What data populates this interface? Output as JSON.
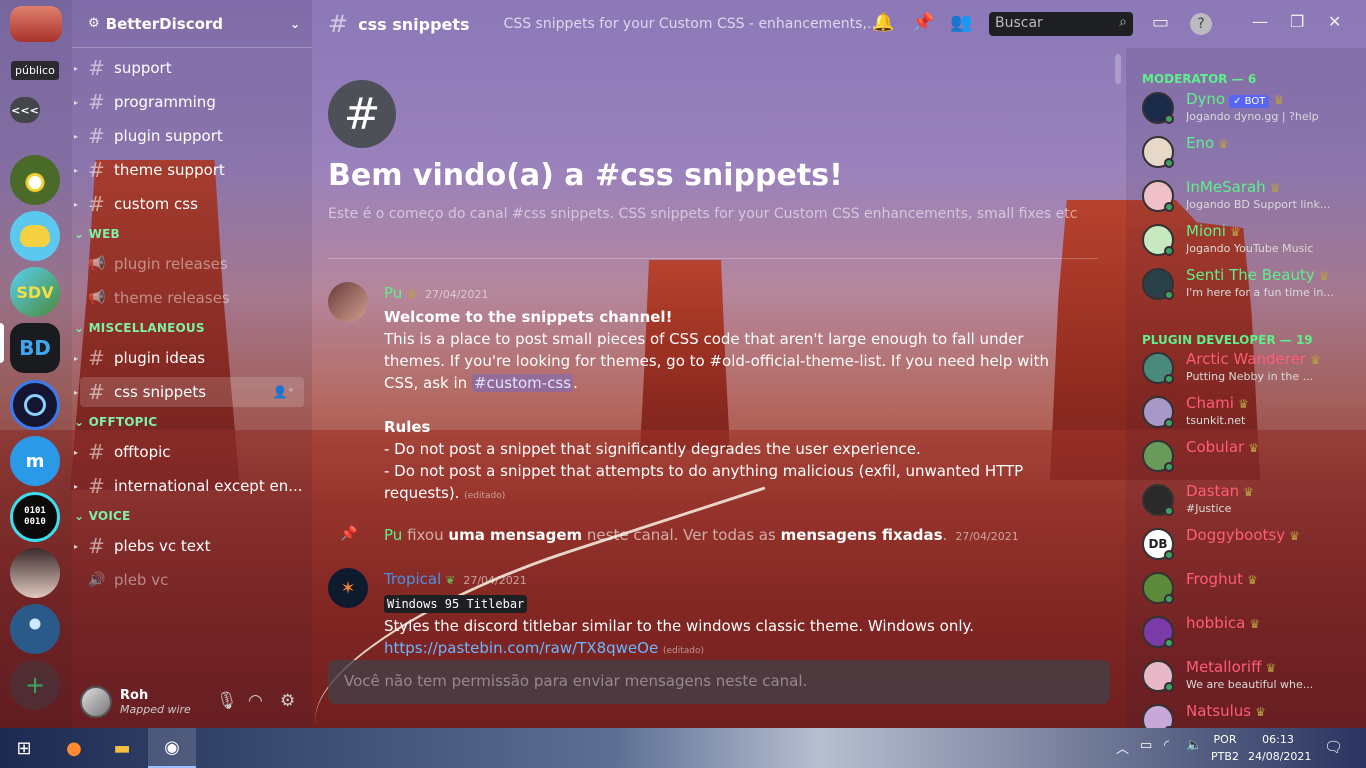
{
  "servers": {
    "tooltip": "público",
    "collapse_label": "<<<",
    "bd_label": "BD",
    "sdv_label": "SDV",
    "binary_label": "0101\n0010",
    "add_label": "+"
  },
  "guild": {
    "name": "BetterDiscord"
  },
  "channels": [
    {
      "name": "support",
      "type": "text"
    },
    {
      "name": "programming",
      "type": "text"
    },
    {
      "name": "plugin support",
      "type": "text"
    },
    {
      "name": "theme support",
      "type": "text"
    },
    {
      "name": "custom css",
      "type": "text"
    },
    {
      "category": "WEB"
    },
    {
      "name": "plugin releases",
      "type": "announce"
    },
    {
      "name": "theme releases",
      "type": "announce"
    },
    {
      "category": "MISCELLANEOUS"
    },
    {
      "name": "plugin ideas",
      "type": "text"
    },
    {
      "name": "css snippets",
      "type": "text",
      "selected": true
    },
    {
      "category": "OFFTOPIC"
    },
    {
      "name": "offtopic",
      "type": "text"
    },
    {
      "name": "international except en...",
      "type": "text"
    },
    {
      "category": "VOICE"
    },
    {
      "name": "plebs vc text",
      "type": "text"
    },
    {
      "name": "pleb vc",
      "type": "voice"
    }
  ],
  "user": {
    "name": "Roh",
    "status": "Mapped wire"
  },
  "header": {
    "channel": "css snippets",
    "topic": "CSS snippets for your Custom CSS - enhancements, sm...",
    "search_placeholder": "Buscar"
  },
  "welcome": {
    "title": "Bem vindo(a) a #css snippets!",
    "subtitle": "Este é o começo do canal #css snippets. CSS snippets for your Custom CSS enhancements, small fixes etc"
  },
  "messages": {
    "m1": {
      "author": "Pu",
      "date": "27/04/2021",
      "title": "Welcome to the snippets channel!",
      "p1a": "This is a place to post small pieces of CSS code that aren't large enough to fall under themes. If you're looking for themes, go to #old-official-theme-list. If you need help with CSS, ask in ",
      "mention": "#custom-css",
      "p1b": ".",
      "rules_title": "Rules",
      "rule1": "- Do not post a snippet that significantly degrades the user experience.",
      "rule2": "- Do not post a snippet that attempts to do anything malicious (exfil, unwanted HTTP requests).",
      "edited": "(editado)"
    },
    "pin": {
      "author": "Pu",
      "t1": " fixou ",
      "t2": "uma mensagem",
      "t3": " neste canal. Ver todas as ",
      "t4": "mensagens fixadas",
      "t5": ".",
      "date": "27/04/2021"
    },
    "m2": {
      "author": "Tropical",
      "date": "27/04/2021",
      "code": "Windows 95 Titlebar",
      "text": "Styles the discord titlebar similar to the windows classic theme. Windows only.",
      "link": "https://pastebin.com/raw/TX8qweOe",
      "edited": "(editado)"
    }
  },
  "input": {
    "placeholder": "Você não tem permissão para enviar mensagens neste canal."
  },
  "members": {
    "moderator_header": "MODERATOR — 6",
    "moderators": [
      {
        "name": "Dyno",
        "badge": "✓ BOT",
        "sub": "Jogando dyno.gg | ?help",
        "color": "#5ef08c",
        "avatar": "#1a2b4a"
      },
      {
        "name": "Eno",
        "sub": "",
        "color": "#5ef08c",
        "avatar": "#e8d8c8"
      },
      {
        "name": "InMeSarah",
        "sub": "Jogando BD Support link...",
        "color": "#5ef08c",
        "avatar": "#f0c0c8"
      },
      {
        "name": "Mioni",
        "sub": "Jogando YouTube Music",
        "color": "#5ef08c",
        "avatar": "#c8e8c0"
      },
      {
        "name": "Senti The Beauty",
        "sub": "I'm here for a fun time in...",
        "color": "#5ef08c",
        "avatar": "#2a4048"
      }
    ],
    "plugin_header": "PLUGIN DEVELOPER — 19",
    "plugin_devs": [
      {
        "name": "Arctic Wanderer",
        "sub": "Putting Nebby in the ...",
        "color": "#ff5c78",
        "avatar": "#4a8a7a"
      },
      {
        "name": "Chami",
        "sub": "tsunkit.net",
        "color": "#ff5c78",
        "avatar": "#a898c8"
      },
      {
        "name": "Cobular",
        "sub": "",
        "color": "#ff5c78",
        "avatar": "#6a9a5a"
      },
      {
        "name": "Dastan",
        "sub": "#Justice",
        "color": "#ff5c78",
        "avatar": "#2a2a2a"
      },
      {
        "name": "Doggybootsy",
        "sub": "",
        "color": "#ff5c78",
        "avatar": "#ffffff",
        "initials": "DB"
      },
      {
        "name": "Froghut",
        "sub": "",
        "color": "#ff5c78",
        "avatar": "#5a8a3a"
      },
      {
        "name": "hobbica",
        "sub": "",
        "color": "#ff5c78",
        "avatar": "#7a3aa8"
      },
      {
        "name": "Metalloriff",
        "sub": "We are beautiful whe...",
        "color": "#ff5c78",
        "avatar": "#e8b8c8"
      },
      {
        "name": "Natsulus",
        "sub": "",
        "color": "#ff5c78",
        "avatar": "#c8a8d8"
      }
    ]
  },
  "taskbar": {
    "lang1": "POR",
    "lang2": "PTB2",
    "time": "06:13",
    "date": "24/08/2021"
  }
}
